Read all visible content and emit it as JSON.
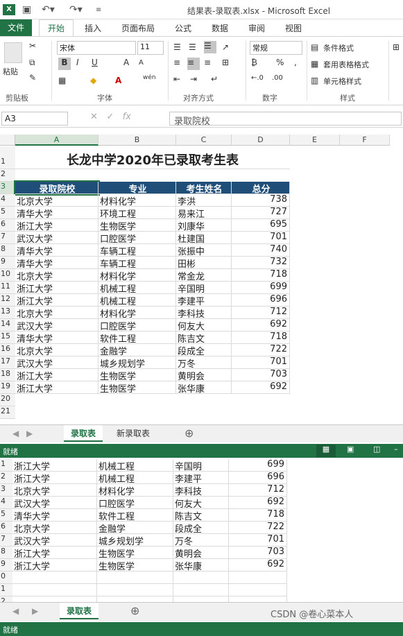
{
  "app": {
    "window_title": "结果表-录取表.xlsx - Microsoft Excel",
    "logo": "X",
    "accent": "#217346",
    "header_fill": "#1f4e79"
  },
  "tabs": [
    "文件",
    "开始",
    "插入",
    "页面布局",
    "公式",
    "数据",
    "审阅",
    "视图"
  ],
  "ribbon": {
    "paste": "粘贴",
    "clipboard": "剪贴板",
    "font_name": "宋体",
    "font_size": "11",
    "bold": "B",
    "italic": "I",
    "underline": "U",
    "grow": "A",
    "shrink": "A",
    "font_color": "A",
    "wen": "wén",
    "font_group": "字体",
    "align_group": "对齐方式",
    "number_format": "常规",
    "percent": "%",
    "comma": ",",
    "dec_inc": "←.0",
    "dec_dec": ".00",
    "number_group": "数字",
    "cond_format": "条件格式",
    "table_format": "套用表格格式",
    "cell_style": "单元格样式",
    "style_group": "样式"
  },
  "formula_bar": {
    "name_box": "A3",
    "fx": "fx",
    "value": "录取院校"
  },
  "columns": [
    "A",
    "B",
    "C",
    "D",
    "E",
    "F"
  ],
  "sheet_title": "长龙中学2020年已录取考生表",
  "headers": [
    "录取院校",
    "专业",
    "考生姓名",
    "总分"
  ],
  "rows": [
    {
      "r": "4",
      "school": "北京大学",
      "major": "材料化学",
      "name": "李洪",
      "score": "738"
    },
    {
      "r": "5",
      "school": "清华大学",
      "major": "环境工程",
      "name": "易来江",
      "score": "727"
    },
    {
      "r": "6",
      "school": "浙江大学",
      "major": "生物医学",
      "name": "刘康华",
      "score": "695"
    },
    {
      "r": "7",
      "school": "武汉大学",
      "major": "口腔医学",
      "name": "杜建国",
      "score": "701"
    },
    {
      "r": "8",
      "school": "清华大学",
      "major": "车辆工程",
      "name": "张振中",
      "score": "740"
    },
    {
      "r": "9",
      "school": "清华大学",
      "major": "车辆工程",
      "name": "田彬",
      "score": "732"
    },
    {
      "r": "10",
      "school": "北京大学",
      "major": "材料化学",
      "name": "常金龙",
      "score": "718"
    },
    {
      "r": "11",
      "school": "浙江大学",
      "major": "机械工程",
      "name": "辛国明",
      "score": "699"
    },
    {
      "r": "12",
      "school": "浙江大学",
      "major": "机械工程",
      "name": "李建平",
      "score": "696"
    },
    {
      "r": "13",
      "school": "北京大学",
      "major": "材料化学",
      "name": "李科技",
      "score": "712"
    },
    {
      "r": "14",
      "school": "武汉大学",
      "major": "口腔医学",
      "name": "何友大",
      "score": "692"
    },
    {
      "r": "15",
      "school": "清华大学",
      "major": "软件工程",
      "name": "陈吉文",
      "score": "718"
    },
    {
      "r": "16",
      "school": "北京大学",
      "major": "金融学",
      "name": "段成全",
      "score": "722"
    },
    {
      "r": "17",
      "school": "武汉大学",
      "major": "城乡规划学",
      "name": "万冬",
      "score": "701"
    },
    {
      "r": "18",
      "school": "浙江大学",
      "major": "生物医学",
      "name": "黄明会",
      "score": "703"
    },
    {
      "r": "19",
      "school": "浙江大学",
      "major": "生物医学",
      "name": "张华康",
      "score": "692"
    }
  ],
  "empty_rows": [
    "20",
    "21"
  ],
  "sheet_tabs": [
    "录取表",
    "新录取表"
  ],
  "add_sheet": "⊕",
  "status": "就绪",
  "lower": {
    "row_labels": [
      "1",
      "2",
      "3",
      "4",
      "5",
      "6",
      "7",
      "8",
      "9",
      "0",
      "1",
      "2"
    ],
    "rows": [
      {
        "school": "浙江大学",
        "major": "机械工程",
        "name": "辛国明",
        "score": "699"
      },
      {
        "school": "浙江大学",
        "major": "机械工程",
        "name": "李建平",
        "score": "696"
      },
      {
        "school": "北京大学",
        "major": "材料化学",
        "name": "李科技",
        "score": "712"
      },
      {
        "school": "武汉大学",
        "major": "口腔医学",
        "name": "何友大",
        "score": "692"
      },
      {
        "school": "清华大学",
        "major": "软件工程",
        "name": "陈吉文",
        "score": "718"
      },
      {
        "school": "北京大学",
        "major": "金融学",
        "name": "段成全",
        "score": "722"
      },
      {
        "school": "武汉大学",
        "major": "城乡规划学",
        "name": "万冬",
        "score": "701"
      },
      {
        "school": "浙江大学",
        "major": "生物医学",
        "name": "黄明会",
        "score": "703"
      },
      {
        "school": "浙江大学",
        "major": "生物医学",
        "name": "张华康",
        "score": "692"
      }
    ],
    "sheet_tabs": [
      "录取表"
    ],
    "status": "就绪",
    "watermark": "CSDN @卷心菜本人"
  }
}
